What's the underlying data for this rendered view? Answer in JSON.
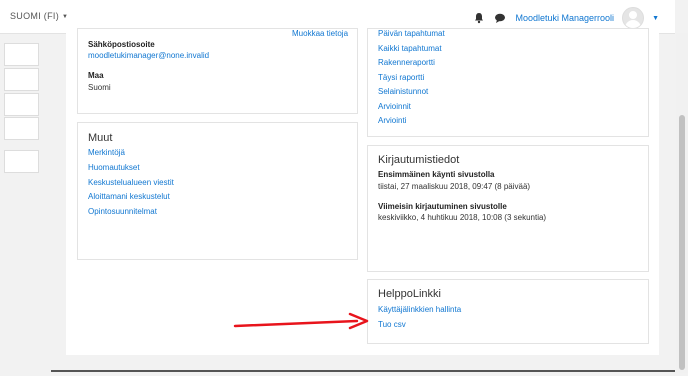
{
  "navbar": {
    "language": "SUOMI (FI)",
    "username": "Moodletuki Managerrooli",
    "icons": [
      "bell-icon",
      "chat-icon",
      "avatar",
      "chevron-down-icon"
    ]
  },
  "left_col": {
    "contact": {
      "edit_link": "Muokkaa tietoja",
      "email_label": "Sähköpostiosoite",
      "email_value": "moodletukimanager@none.invalid",
      "country_label": "Maa",
      "country_value": "Suomi"
    },
    "misc": {
      "title": "Muut",
      "links": [
        "Merkintöjä",
        "Huomautukset",
        "Keskustelualueen viestit",
        "Aloittamani keskustelut",
        "Opintosuunnitelmat"
      ]
    }
  },
  "right_col": {
    "reports": {
      "links": [
        "Päivän tapahtumat",
        "Kaikki tapahtumat",
        "Rakenneraportti",
        "Täysi raportti",
        "Selainistunnot",
        "Arvioinnit",
        "Arviointi"
      ]
    },
    "login": {
      "title": "Kirjautumistiedot",
      "first_label": "Ensimmäinen käynti sivustolla",
      "first_value": "tiistai, 27 maaliskuu 2018, 09:47  (8 päivää)",
      "last_label": "Viimeisin kirjautuminen sivustolle",
      "last_value": "keskiviikko, 4 huhtikuu 2018, 10:08  (3 sekuntia)"
    },
    "easylink": {
      "title": "HelppoLinkki",
      "links": [
        "Käyttäjälinkkien hallinta",
        "Tuo csv"
      ]
    }
  },
  "colors": {
    "link": "#1177d1",
    "arrow": "#e8141c"
  }
}
